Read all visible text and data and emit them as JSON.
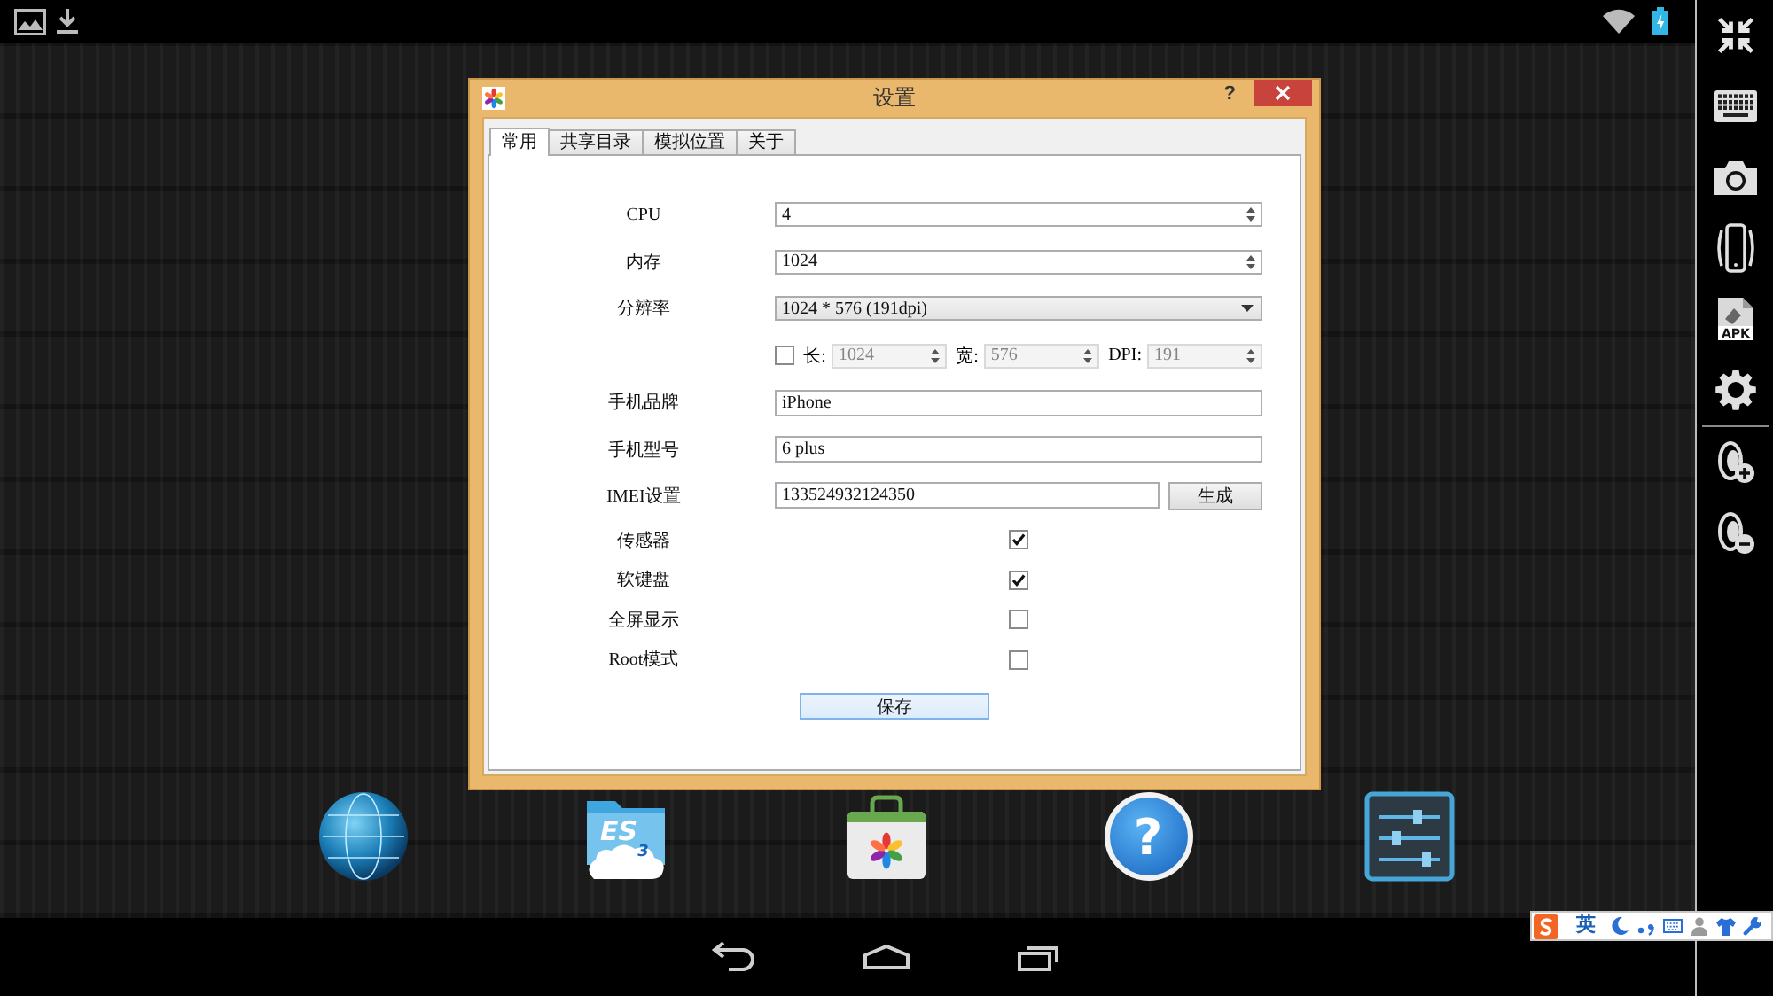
{
  "dialog": {
    "title": "设置",
    "help": "?",
    "tabs": [
      {
        "label": "常用",
        "selected": true
      },
      {
        "label": "共享目录",
        "selected": false
      },
      {
        "label": "模拟位置",
        "selected": false
      },
      {
        "label": "关于",
        "selected": false
      }
    ],
    "rows": [
      {
        "kind": "spinner",
        "label": "CPU",
        "value": "4"
      },
      {
        "kind": "spinner",
        "label": "内存",
        "value": "1024"
      },
      {
        "kind": "dropdown",
        "label": "分辨率",
        "value": "1024 * 576 (191dpi)"
      },
      {
        "kind": "size",
        "checked": false,
        "fields": [
          {
            "label": "长:",
            "value": "1024",
            "disabled": true
          },
          {
            "label": "宽:",
            "value": "576",
            "disabled": true
          },
          {
            "label": "DPI:",
            "value": "191",
            "disabled": true
          }
        ]
      },
      {
        "kind": "text",
        "label": "手机品牌",
        "value": "iPhone"
      },
      {
        "kind": "text",
        "label": "手机型号",
        "value": "6 plus"
      },
      {
        "kind": "text_button",
        "label": "IMEI设置",
        "value": "133524932124350",
        "button": "生成"
      },
      {
        "kind": "checkbox",
        "label": "传感器",
        "checked": true
      },
      {
        "kind": "checkbox",
        "label": "软键盘",
        "checked": true
      },
      {
        "kind": "checkbox",
        "label": "全屏显示",
        "checked": false
      },
      {
        "kind": "checkbox",
        "label": "Root模式",
        "checked": false
      }
    ],
    "save_button": "保存"
  },
  "sidebar": {
    "apk_label": "APK"
  },
  "dock": {
    "folder_label": "ES$_{3}$",
    "help_glyph": "?"
  },
  "ime_toolbar": {
    "mode": "英"
  }
}
